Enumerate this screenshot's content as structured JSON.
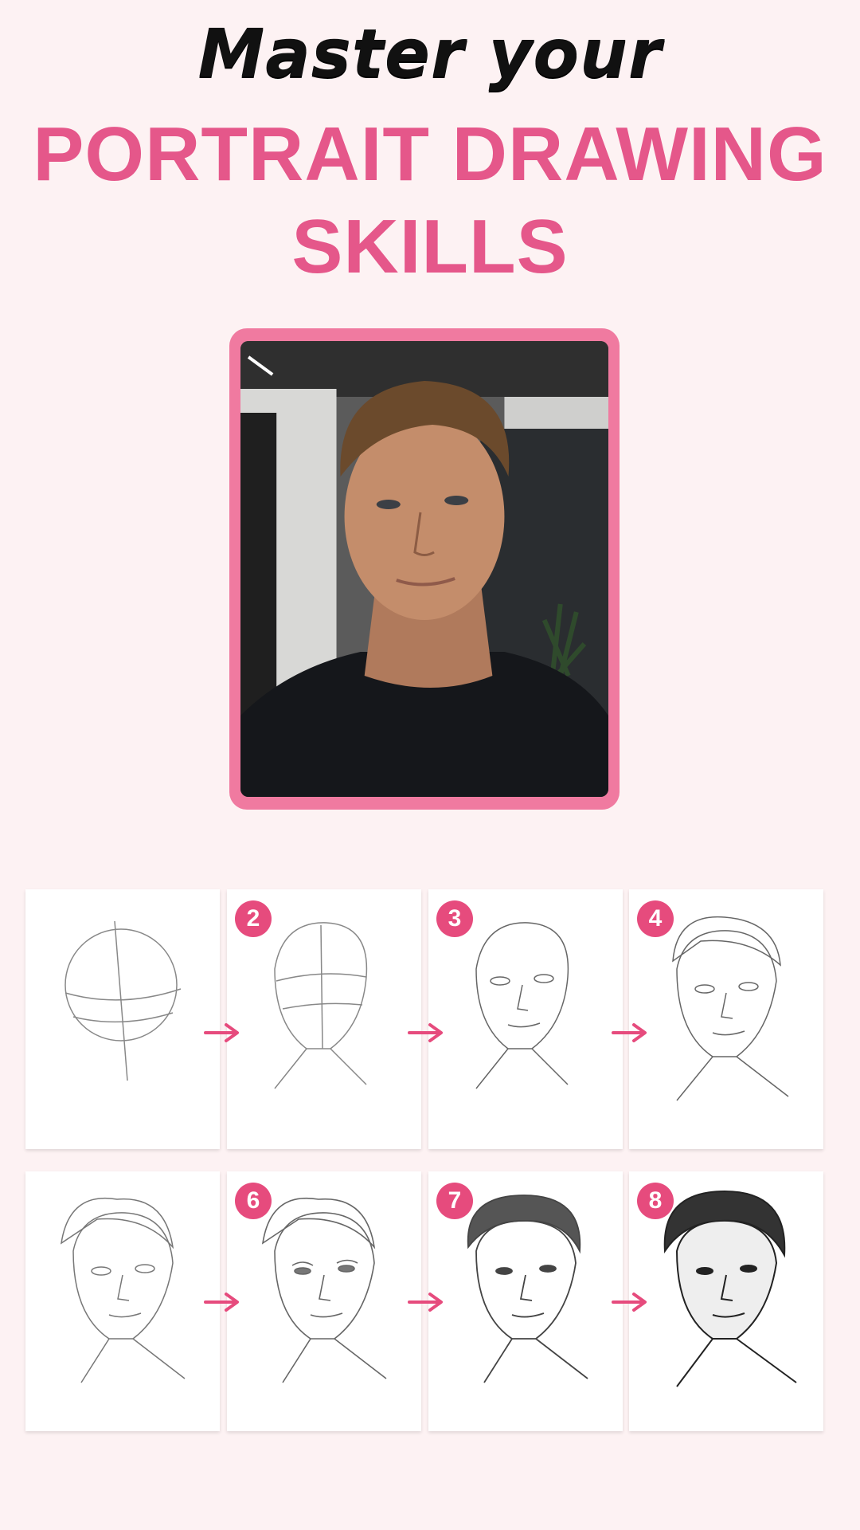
{
  "header": {
    "line1": "Master your",
    "line2": "PORTRAIT DRAWING",
    "line3": "SKILLS"
  },
  "colors": {
    "accent": "#e5578a",
    "frame": "#f07aa0",
    "badge": "#e64b7d",
    "background": "#fdf2f3"
  },
  "reference_photo": {
    "icon": "portrait-photo"
  },
  "steps": [
    {
      "badge": ""
    },
    {
      "badge": "2"
    },
    {
      "badge": "3"
    },
    {
      "badge": "4"
    },
    {
      "badge": ""
    },
    {
      "badge": "6"
    },
    {
      "badge": "7"
    },
    {
      "badge": "8"
    }
  ],
  "arrow_icon": "arrow-right-icon"
}
